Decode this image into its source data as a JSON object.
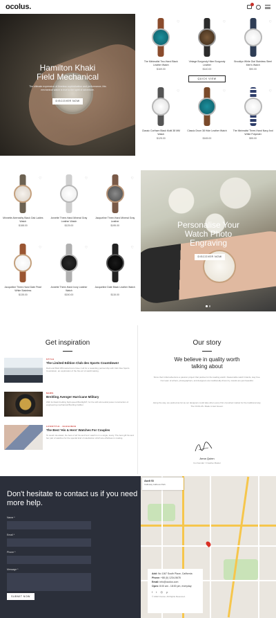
{
  "header": {
    "logo": "ocolus.",
    "icons": [
      "cart-icon",
      "search-icon",
      "menu-icon"
    ],
    "accent": "#c8312a"
  },
  "hero1": {
    "title": "Hamilton Khaki Field Mechanical",
    "text": "The ultimate expression of timeless sophistication and performance, this mechanical watch is true to the spirit of adventure.",
    "button": "DISCOVER NOW"
  },
  "products_top": [
    {
      "name": "The Minimalist Two-Hand Black Leather Watch",
      "price": "$169.00"
    },
    {
      "name": "Vintage Burgundy Hiker Burgundy Leather",
      "price": "$140.00"
    },
    {
      "name": "Brooklyn White Dial Stainless Steel Men's Watch",
      "price": "$90.00"
    },
    {
      "name": "Classic Cortham Black Multi 38 MM Watch",
      "price": "$125.00"
    },
    {
      "name": "Classic Drum 38 Hide Leather Watch",
      "price": "$165.00"
    },
    {
      "name": "The Minimalist Three-Hand Navy And White Polyester",
      "price": "$95.00"
    }
  ],
  "quick_view": "QUICK VIEW",
  "products_bottom": [
    {
      "name": "Minnette Abernathy Black Oak Ladies Watch",
      "price": "$188.00"
    },
    {
      "name": "Annette Three-Hand Mineral Gray Leather Watch",
      "price": "$125.00"
    },
    {
      "name": "Jacqueline Three-Hand Mineral Gray Leather",
      "price": "$195.00"
    },
    {
      "name": "Jacqueline Three-Hand Date Pearl White Stainless",
      "price": "$135.00"
    },
    {
      "name": "Annette Three-Hand Ivory Leather Watch",
      "price": "$150.00"
    },
    {
      "name": "Jacqueline Date Black Leather Watch",
      "price": "$115.00"
    }
  ],
  "hero2": {
    "title": "Personalise Your Watch Photo Engraving",
    "button": "DISCOVER NOW"
  },
  "inspiration": {
    "title": "Get inspiration",
    "posts": [
      {
        "category": "STYLE",
        "title": "The Limited Edition Club des Sports Countdown!",
        "excerpt": "Dark and Bold Whimsical Icons have it all for a rewarding partnership with Club Des Sports Countdown, an exploration of the fine art of watchmaking."
      },
      {
        "category": "NEWS",
        "title": "Breitling Avenger Hurricane Military",
        "excerpt": "With its black breitling high-speed Breitlight®, for the with all-neutral power construction of engineering mechanical Breitling Caliber."
      },
      {
        "category": "LIFESTYLE · ELEGANCE",
        "title": "The Best 'His & Hers' Watches For Couples",
        "excerpt": "To avoid mis-dated, the best of all 'his and hers' watch is in a single, lovely. The best gift his and her pair of watches for the special kind of celebration which are effortless in making."
      }
    ]
  },
  "story": {
    "title": "Our story",
    "subtitle": "We believe in quality worth talking about",
    "p1": "Since their initial adventure a passion project that pushes for the leading watch. Reasonable watch brands, stay free. Our team of writers, photographers, and designers are traditionally driven by. Hands are just beautiful.",
    "p2": "Along the way, we pushed as far as our designers could take when every first of pushed market for the traditional way. The OCOLUS. Made to last forever.",
    "name": "Anna Quinn",
    "role": "Co-Founder / Creative Master"
  },
  "contact": {
    "title": "Don't hesitate to contact us if you need more help.",
    "fields": [
      {
        "label": "Name *"
      },
      {
        "label": "Email *"
      },
      {
        "label": "Phone *"
      },
      {
        "label": "Message *"
      }
    ],
    "button": "SUBMIT NOW"
  },
  "map": {
    "card_title": "Audi SI",
    "card_sub": "Calloway Address Park",
    "info": {
      "address_label": "Add:",
      "address": "No 1167 South Place, California",
      "phone_label": "Phone:",
      "phone": "+88 (0) 1234-5678",
      "email_label": "Email:",
      "email": "info@ocolus.com",
      "open_label": "Open:",
      "open": "8:00 am - 18:00 pm, everyday"
    },
    "copyright": "© 2022 Ocolus. All Rights Reserved."
  }
}
